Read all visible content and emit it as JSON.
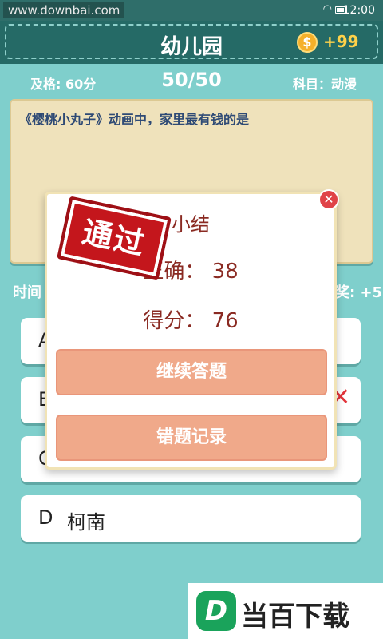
{
  "statusbar": {
    "watermark": "www.downbai.com",
    "time": "12:00"
  },
  "header": {
    "title": "幼儿园",
    "coin_icon": "dollar-coin-icon",
    "coin_count": "+99"
  },
  "info": {
    "pass_score": "及格: 60分",
    "progress": "50/50",
    "subject": "科目：动漫"
  },
  "question": {
    "text": "《樱桃小丸子》动画中，家里最有钱的是"
  },
  "timer": {
    "label_fragment": "时间",
    "bonus_fragment": "奖: +5"
  },
  "options": [
    {
      "letter": "A",
      "text": ""
    },
    {
      "letter": "B",
      "text": ""
    },
    {
      "letter": "C",
      "text": ""
    },
    {
      "letter": "D",
      "text": "柯南"
    }
  ],
  "summary": {
    "title": "小结",
    "correct_line": "正确：  38",
    "score_line": "得分：  76",
    "continue_label": "继续答题",
    "wrong_record_label": "错题记录",
    "stamp_text": "通过",
    "close_icon": "close-icon"
  },
  "brand": {
    "logo_letter": "D",
    "text": "当百下载"
  },
  "colors": {
    "background": "#7fcfcc",
    "header": "#256a66",
    "button": "#f0a98a",
    "stamp": "#c4161c",
    "summary_text": "#8a2a22"
  }
}
